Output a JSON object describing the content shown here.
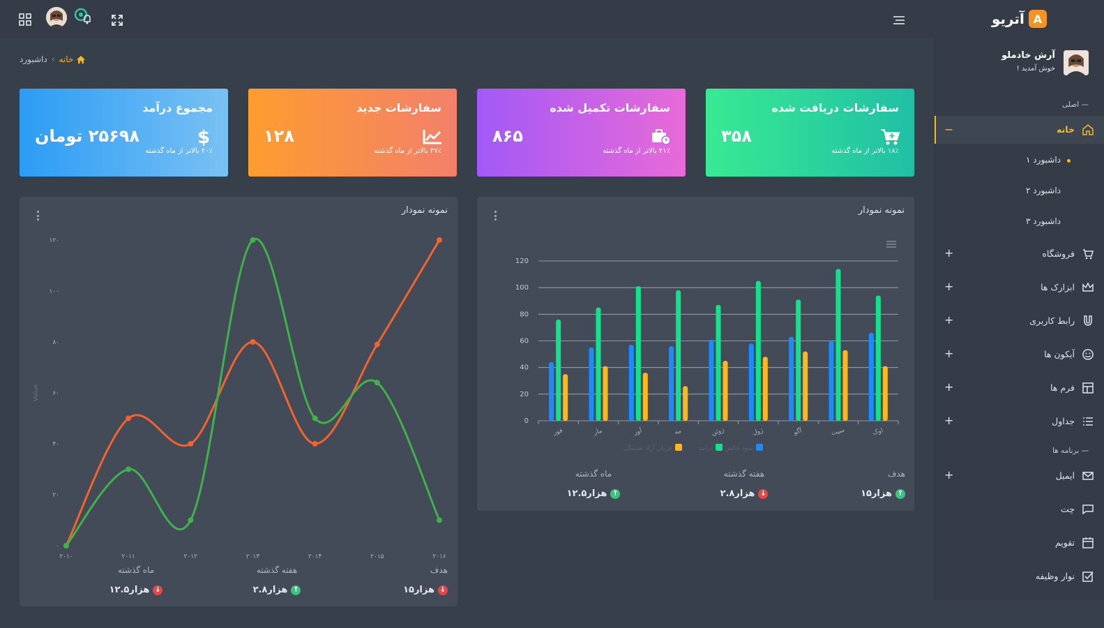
{
  "brand": {
    "name": "آتریو",
    "logo_letter": "A"
  },
  "user": {
    "name": "آرش خادملو",
    "greeting": "خوش آمدید !"
  },
  "breadcrumb": {
    "home": "خانه",
    "current": "داشبورد"
  },
  "cards": [
    {
      "title": "مجموع درآمد",
      "value": "۲۵۶۹۸ تومان",
      "sub": "۲۰٪ بالاتر از ماه گذشته",
      "icon": "dollar-icon"
    },
    {
      "title": "سفارشات جدید",
      "value": "۱۲۸",
      "sub": "۳۷٪ بالاتر از ماه گذشته",
      "icon": "chart-line-icon"
    },
    {
      "title": "سفارشات تکمیل شده",
      "value": "۸۶۵",
      "sub": "۲۱٪ بالاتر از ماه گذشته",
      "icon": "briefcase-clock-icon"
    },
    {
      "title": "سفارشات دریافت شده",
      "value": "۳۵۸",
      "sub": "۱۸٪ بالاتر از ماه گذشته",
      "icon": "cart-plus-icon"
    }
  ],
  "nav": {
    "section_main": "اصلی",
    "home": "خانه",
    "dash1": "داشبورد ۱",
    "dash2": "داشبورد ۲",
    "dash3": "داشبورد ۳",
    "shop": "فروشگاه",
    "tools": "ابزارک ها",
    "ui": "رابط کاربری",
    "icons": "آیکون ها",
    "forms": "فرم ها",
    "tables": "جداول",
    "section_apps": "برنامه ها",
    "email": "ایمیل",
    "chat": "چت",
    "calendar": "تقویم",
    "taskbar": "نوار وظیفه"
  },
  "line_panel": {
    "title": "نمونه نمودار",
    "stats": [
      {
        "label": "ماه گذشته",
        "value": "۱۲.۵هزار",
        "trend": "down"
      },
      {
        "label": "هفته گذشته",
        "value": "۲.۸هزار",
        "trend": "up"
      },
      {
        "label": "هدف",
        "value": "۱۵هزار",
        "trend": "down"
      }
    ]
  },
  "bar_panel": {
    "title": "نمونه نمودار",
    "stats": [
      {
        "label": "ماه گذشته",
        "value": "۱۲.۵هزار",
        "trend": "up"
      },
      {
        "label": "هفته گذشته",
        "value": "۲.۸هزار",
        "trend": "down"
      },
      {
        "label": "هدف",
        "value": "۱۵هزار",
        "trend": "up"
      }
    ]
  },
  "colors": {
    "accent": "#f7b924",
    "line_orange": "#f4632b",
    "line_green": "#3fb24a",
    "bar_blue": "#1b8cff",
    "bar_green": "#10e38c",
    "bar_yellow": "#fdb81e"
  },
  "chart_data": [
    {
      "type": "line",
      "x": [
        "۲۰۱۰",
        "۲۰۱۱",
        "۲۰۱۲",
        "۲۰۱۳",
        "۲۰۱۴",
        "۲۰۱۵",
        "۲۰۱۶"
      ],
      "series": [
        {
          "values": [
            0,
            50,
            40,
            80,
            40,
            79,
            120
          ]
        },
        {
          "values": [
            0,
            30,
            10,
            120,
            50,
            64,
            10
          ]
        }
      ],
      "ylabel": "Value",
      "yticks": [
        "۰",
        "۲۰",
        "۴۰",
        "۶۰",
        "۸۰",
        "۱۰۰",
        "۱۲۰"
      ],
      "ylim": [
        0,
        120
      ],
      "grid": false
    },
    {
      "type": "bar",
      "categories": [
        "فور",
        "مار",
        "آور",
        "مه",
        "ژوئن",
        "ژول",
        "آگو",
        "سپت",
        "اوک"
      ],
      "series": [
        {
          "name": "سود خالص",
          "values": [
            44,
            55,
            57,
            56,
            61,
            58,
            63,
            60,
            66
          ]
        },
        {
          "name": "درآمد",
          "values": [
            76,
            85,
            101,
            98,
            87,
            105,
            91,
            114,
            94
          ]
        },
        {
          "name": "جریان آزاد نقدینگی",
          "values": [
            35,
            41,
            36,
            26,
            45,
            48,
            52,
            53,
            41
          ]
        }
      ],
      "yticks": [
        "0",
        "20",
        "40",
        "60",
        "80",
        "100",
        "120"
      ],
      "ylim": [
        0,
        120
      ],
      "grid": true,
      "legend": "bottom"
    }
  ]
}
